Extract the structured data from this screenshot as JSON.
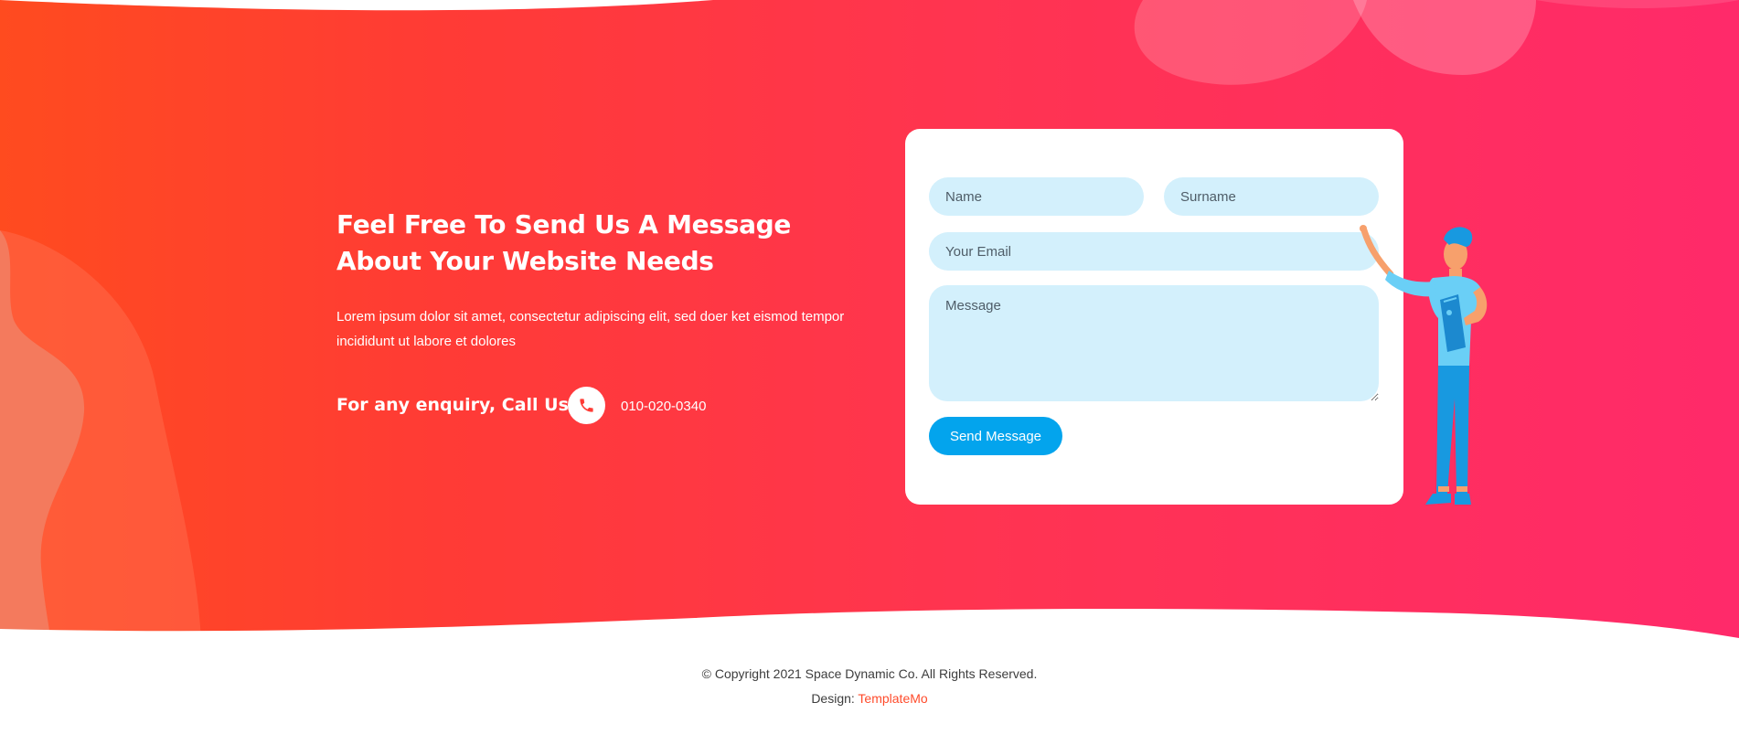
{
  "contact": {
    "heading": "Feel Free To Send Us A Message About Your Website Needs",
    "description": "Lorem ipsum dolor sit amet, consectetur adipiscing elit, sed doer ket eismod tempor incididunt ut labore et dolores",
    "enquiry_label": "For any enquiry, Call Us:",
    "phone_number": "010-020-0340",
    "phone_icon": "phone-icon"
  },
  "form": {
    "name_placeholder": "Name",
    "surname_placeholder": "Surname",
    "email_placeholder": "Your Email",
    "message_placeholder": "Message",
    "submit_label": "Send Message"
  },
  "footer": {
    "copyright": "© Copyright 2021 Space Dynamic Co. All Rights Reserved.",
    "design_prefix": "Design:",
    "design_link": "TemplateMo"
  },
  "colors": {
    "gradient_start": "#ff4b1f",
    "gradient_end": "#ff2a6a",
    "field_background": "#d3f0fc",
    "button": "#03a4ed",
    "link": "#ff4b2b"
  }
}
